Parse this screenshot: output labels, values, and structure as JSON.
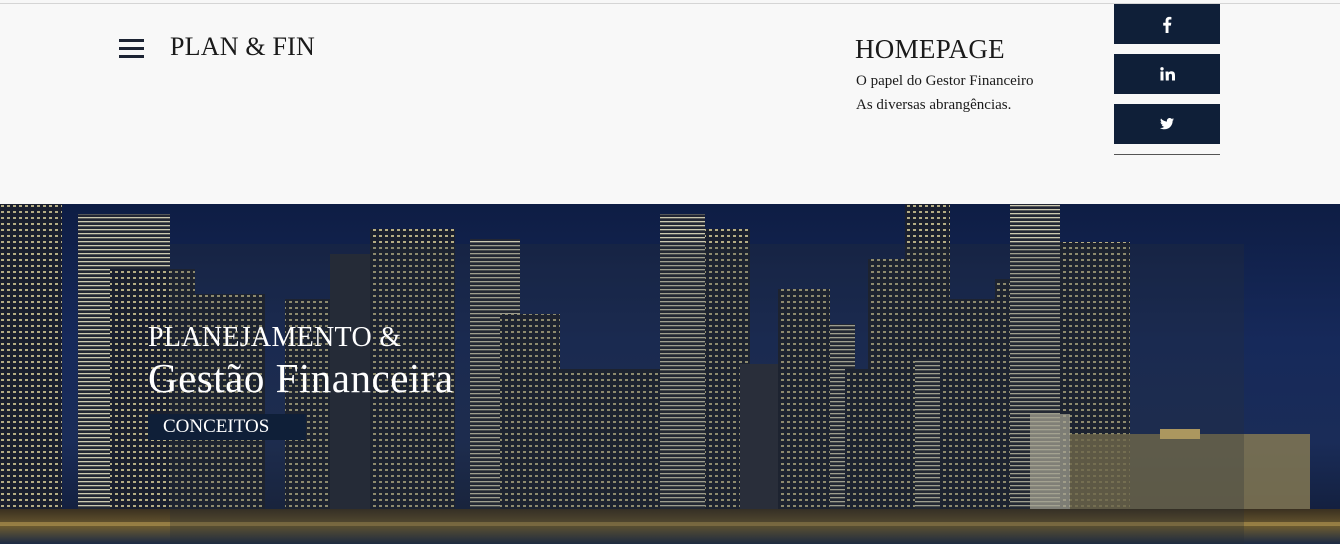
{
  "header": {
    "brand": "PLAN & FIN",
    "menu_icon": "hamburger-menu-icon",
    "nav_title": "HOMEPAGE",
    "nav_links": [
      "O papel do Gestor Financeiro",
      "As diversas abrangências."
    ]
  },
  "social": [
    {
      "name": "facebook",
      "icon": "facebook-icon"
    },
    {
      "name": "linkedin",
      "icon": "linkedin-icon"
    },
    {
      "name": "twitter",
      "icon": "twitter-icon"
    }
  ],
  "hero": {
    "line1": "PLANEJAMENTO &",
    "line2": "Gestão Financeira",
    "button_label": "CONCEITOS",
    "background": "city-skyline-night"
  },
  "colors": {
    "brand_navy": "#0f1f38",
    "text": "#1a1a1a",
    "header_bg": "#f8f8f8"
  }
}
